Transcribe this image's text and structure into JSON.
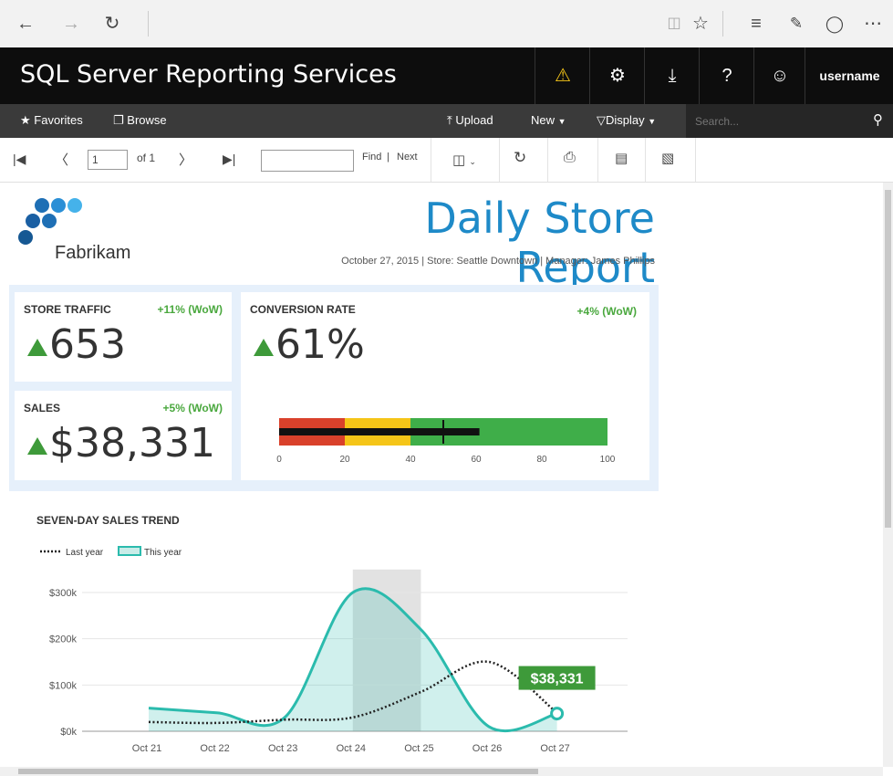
{
  "browser": {
    "reading_view_icon": "book-icon",
    "favorite_icon": "star-icon",
    "hub_icon": "hub-icon",
    "note_icon": "note-icon",
    "share_icon": "share-icon",
    "more_icon": "more-icon"
  },
  "header": {
    "title": "SQL Server Reporting Services",
    "username": "username"
  },
  "nav": {
    "favorites": "Favorites",
    "browse": "Browse",
    "upload": "Upload",
    "new": "New",
    "display": "Display",
    "search_placeholder": "Search..."
  },
  "toolbar": {
    "page_value": "1",
    "of_label": "of 1",
    "find": "Find",
    "separator": "|",
    "next": "Next"
  },
  "report": {
    "logo_text": "Fabrikam",
    "title": "Daily Store Report",
    "subtitle": "October 27, 2015  |  Store: Seattle Downtown  |  Manager: James Phillips",
    "traffic": {
      "label": "STORE TRAFFIC",
      "change": "+11% (WoW)",
      "value": "653"
    },
    "sales": {
      "label": "SALES",
      "change": "+5% (WoW)",
      "value": "$38,331"
    },
    "conversion": {
      "label": "CONVERSION RATE",
      "change": "+4% (WoW)",
      "value": "61%"
    }
  },
  "colors": {
    "accent": "#1e8ac8",
    "green": "#3e9a3a",
    "teal": "#2bbbad",
    "red": "#d9412b",
    "yellow": "#f5c518",
    "bullet_green": "#3fae49"
  },
  "chart_data": [
    {
      "type": "bar",
      "subtype": "bullet",
      "ranges": [
        {
          "from": 0,
          "to": 20,
          "color": "#d9412b"
        },
        {
          "from": 20,
          "to": 40,
          "color": "#f5c518"
        },
        {
          "from": 40,
          "to": 100,
          "color": "#3fae49"
        }
      ],
      "value": 61,
      "target": 50,
      "ticks": [
        "0",
        "20",
        "40",
        "60",
        "80",
        "100"
      ],
      "xlim": [
        0,
        100
      ]
    },
    {
      "type": "area",
      "title": "SEVEN-DAY SALES TREND",
      "categories": [
        "Oct 21",
        "Oct 22",
        "Oct 23",
        "Oct 24",
        "Oct 25",
        "Oct 26",
        "Oct 27"
      ],
      "series": [
        {
          "name": "Last year",
          "style": "dotted",
          "values": [
            20000,
            18000,
            25000,
            30000,
            85000,
            150000,
            40000
          ]
        },
        {
          "name": "This year",
          "style": "area",
          "values": [
            50000,
            40000,
            30000,
            300000,
            220000,
            10000,
            38331
          ]
        }
      ],
      "yticks": [
        "$0k",
        "$100k",
        "$200k",
        "$300k"
      ],
      "ylim": [
        0,
        330000
      ],
      "highlight_category": "Oct 24",
      "callout": "$38,331",
      "legend": "top-left"
    }
  ]
}
